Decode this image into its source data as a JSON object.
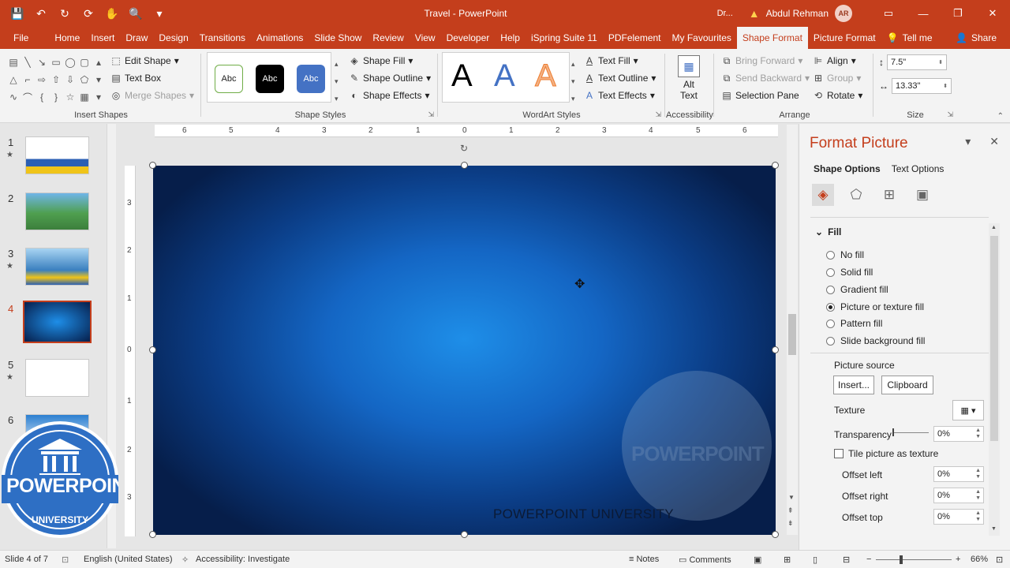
{
  "window": {
    "title": "Travel  -  PowerPoint",
    "dr_label": "Dr...",
    "user_name": "Abdul Rehman",
    "user_initials": "AR",
    "controls": [
      "restore-ribbon",
      "minimize",
      "maximize",
      "close"
    ]
  },
  "qat": {
    "icons": [
      "save-icon",
      "undo-icon",
      "redo-icon",
      "present-icon",
      "touch-icon",
      "print-preview-icon",
      "customize-icon"
    ]
  },
  "tabs": [
    {
      "label": "File"
    },
    {
      "label": "Home"
    },
    {
      "label": "Insert"
    },
    {
      "label": "Draw"
    },
    {
      "label": "Design"
    },
    {
      "label": "Transitions"
    },
    {
      "label": "Animations"
    },
    {
      "label": "Slide Show"
    },
    {
      "label": "Review"
    },
    {
      "label": "View"
    },
    {
      "label": "Developer"
    },
    {
      "label": "Help"
    },
    {
      "label": "iSpring Suite 11"
    },
    {
      "label": "PDFelement"
    },
    {
      "label": "My Favourites"
    },
    {
      "label": "Shape Format"
    },
    {
      "label": "Picture Format"
    },
    {
      "label": "Tell me"
    },
    {
      "label": "Share"
    }
  ],
  "ribbon": {
    "insert_shapes": {
      "label": "Insert Shapes",
      "edit_shape": "Edit Shape",
      "text_box": "Text Box",
      "merge_shapes": "Merge Shapes"
    },
    "shape_styles": {
      "label": "Shape Styles",
      "samples": [
        "Abc",
        "Abc",
        "Abc"
      ],
      "shape_fill": "Shape Fill",
      "shape_outline": "Shape Outline",
      "shape_effects": "Shape Effects"
    },
    "wordart_styles": {
      "label": "WordArt Styles",
      "letters": [
        "A",
        "A",
        "A"
      ],
      "text_fill": "Text Fill",
      "text_outline": "Text Outline",
      "text_effects": "Text Effects"
    },
    "accessibility": {
      "label": "Accessibility",
      "alt_text_1": "Alt",
      "alt_text_2": "Text"
    },
    "arrange": {
      "label": "Arrange",
      "bring_forward": "Bring Forward",
      "send_backward": "Send Backward",
      "selection_pane": "Selection Pane",
      "align": "Align",
      "group": "Group",
      "rotate": "Rotate"
    },
    "size": {
      "label": "Size",
      "height": "7.5\"",
      "width": "13.33\""
    }
  },
  "thumbnails": [
    {
      "num": "1",
      "star": "★"
    },
    {
      "num": "2",
      "star": ""
    },
    {
      "num": "3",
      "star": "★"
    },
    {
      "num": "4",
      "star": ""
    },
    {
      "num": "5",
      "star": "★"
    },
    {
      "num": "6",
      "star": ""
    }
  ],
  "logo": {
    "title": "POWERPOINT",
    "sub": "UNIVERSITY"
  },
  "ruler": {
    "h": [
      "6",
      "5",
      "4",
      "3",
      "2",
      "1",
      "0",
      "1",
      "2",
      "3",
      "4",
      "5",
      "6"
    ],
    "v": [
      "3",
      "2",
      "1",
      "0",
      "1",
      "2",
      "3"
    ]
  },
  "slide": {
    "text": "POWERPOINT UNIVERSITY",
    "watermark": "POWERPOINT"
  },
  "format_pane": {
    "title": "Format Picture",
    "tabs": [
      "Shape Options",
      "Text Options"
    ],
    "section": "Fill",
    "options": [
      "No fill",
      "Solid fill",
      "Gradient fill",
      "Picture or texture fill",
      "Pattern fill",
      "Slide background fill"
    ],
    "selected_option": "Picture or texture fill",
    "picture_source": "Picture source",
    "insert_btn": "Insert...",
    "clipboard_btn": "Clipboard",
    "texture": "Texture",
    "transparency": "Transparency",
    "transparency_val": "0%",
    "tile": "Tile picture as texture",
    "offset_left": "Offset left",
    "offset_left_val": "0%",
    "offset_right": "Offset right",
    "offset_right_val": "0%",
    "offset_top": "Offset top",
    "offset_top_val": "0%"
  },
  "status": {
    "slide_info": "Slide 4 of 7",
    "language": "English (United States)",
    "accessibility": "Accessibility: Investigate",
    "notes": "Notes",
    "comments": "Comments",
    "zoom": "66%"
  },
  "colors": {
    "accent": "#c43e1c",
    "slide_center": "#1e8ee8",
    "slide_edge": "#061e4a"
  }
}
